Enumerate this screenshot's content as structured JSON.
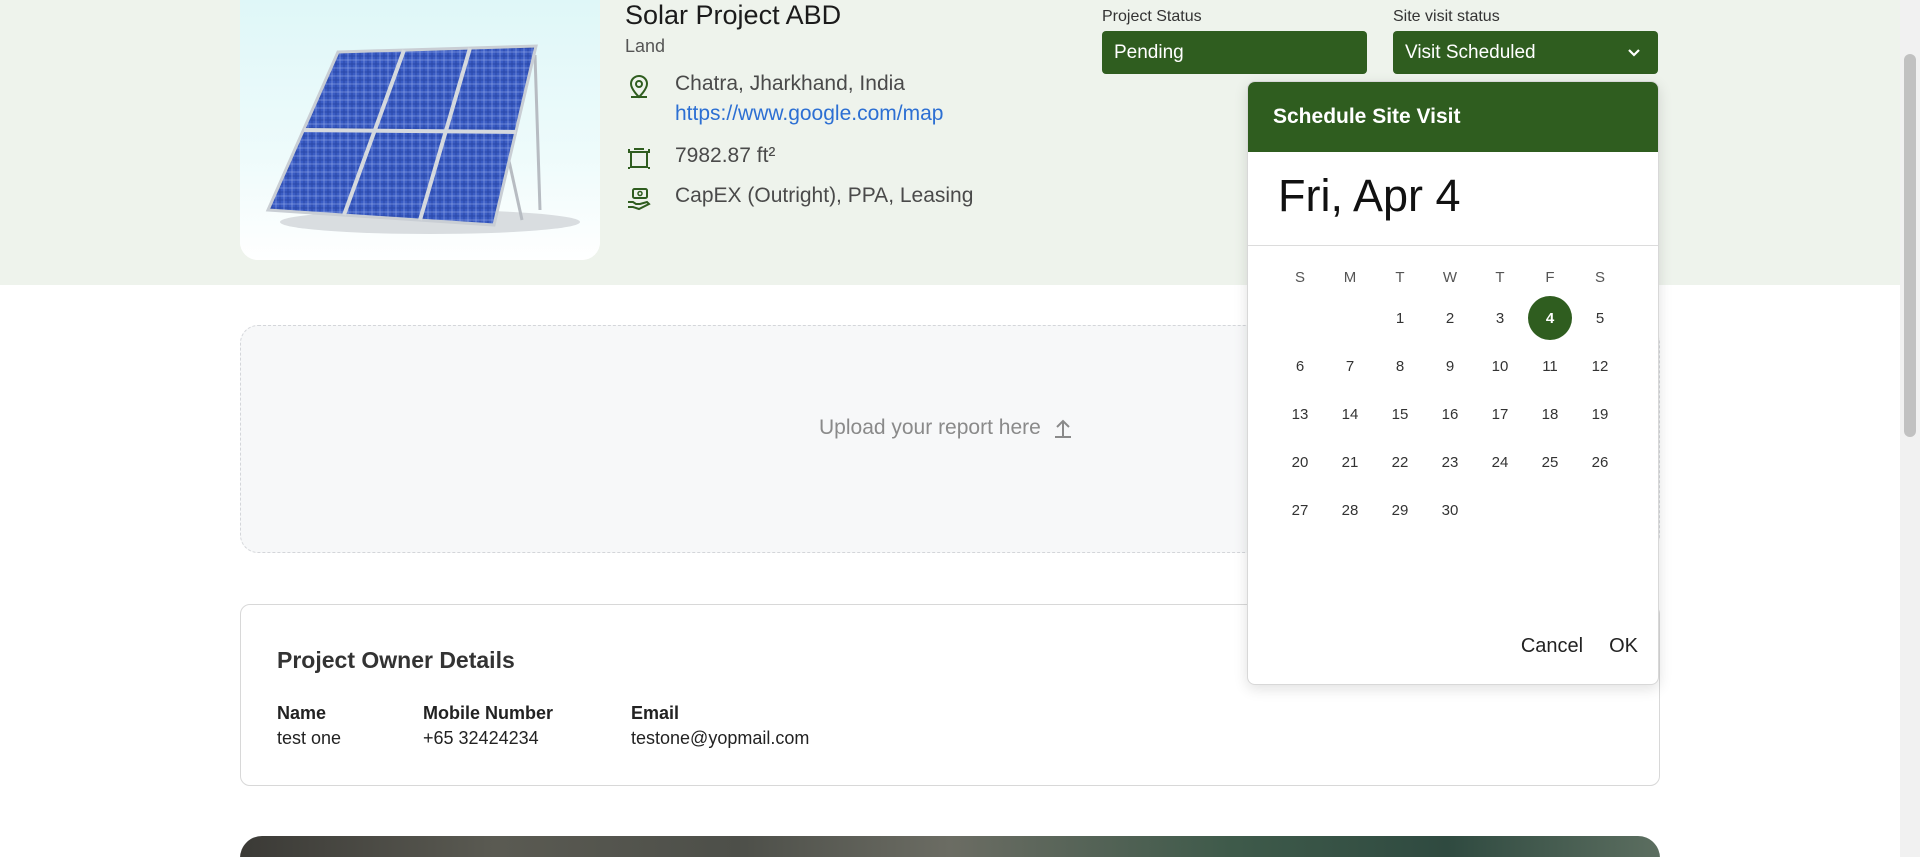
{
  "project": {
    "title": "Solar Project ABD",
    "type": "Land",
    "location": "Chatra, Jharkhand, India",
    "map_link": "https://www.google.com/map",
    "area": "7982.87 ft²",
    "financing": "CapEX (Outright), PPA, Leasing"
  },
  "status": {
    "project_status_label": "Project Status",
    "project_status_value": "Pending",
    "site_visit_label": "Site visit status",
    "site_visit_value": "Visit Scheduled"
  },
  "upload": {
    "text": "Upload your report here"
  },
  "owner": {
    "title": "Project Owner Details",
    "name_label": "Name",
    "name_value": "test one",
    "mobile_label": "Mobile Number",
    "mobile_value": "+65 32424234",
    "email_label": "Email",
    "email_value": "testone@yopmail.com"
  },
  "date_picker": {
    "title": "Schedule Site Visit",
    "selected_date": "Fri, Apr 4",
    "weekdays": [
      "S",
      "M",
      "T",
      "W",
      "T",
      "F",
      "S"
    ],
    "weeks": [
      [
        "",
        "",
        "1",
        "2",
        "3",
        "4",
        "5"
      ],
      [
        "6",
        "7",
        "8",
        "9",
        "10",
        "11",
        "12"
      ],
      [
        "13",
        "14",
        "15",
        "16",
        "17",
        "18",
        "19"
      ],
      [
        "20",
        "21",
        "22",
        "23",
        "24",
        "25",
        "26"
      ],
      [
        "27",
        "28",
        "29",
        "30",
        "",
        "",
        ""
      ]
    ],
    "selected_day": "4",
    "cancel_label": "Cancel",
    "ok_label": "OK"
  },
  "colors": {
    "accent_green": "#2f5d1f",
    "hero_bg": "#eef3ec",
    "link_blue": "#2c6fd3"
  },
  "icons": {
    "location": "map-pin-icon",
    "area": "area-icon",
    "financing": "hand-money-icon",
    "upload": "upload-arrow-icon",
    "dropdown": "chevron-down-icon"
  }
}
